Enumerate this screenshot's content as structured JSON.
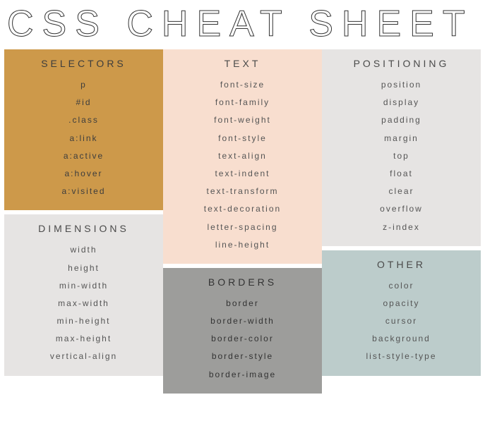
{
  "title": "CSS CHEAT SHEET",
  "sections": {
    "selectors": {
      "header": "SELECTORS",
      "items": [
        "p",
        "#id",
        ".class",
        "a:link",
        "a:active",
        "a:hover",
        "a:visited"
      ]
    },
    "dimensions": {
      "header": "DIMENSIONS",
      "items": [
        "width",
        "height",
        "min-width",
        "max-width",
        "min-height",
        "max-height",
        "vertical-align"
      ]
    },
    "text": {
      "header": "TEXT",
      "items": [
        "font-size",
        "font-family",
        "font-weight",
        "font-style",
        "text-align",
        "text-indent",
        "text-transform",
        "text-decoration",
        "letter-spacing",
        "line-height"
      ]
    },
    "borders": {
      "header": "BORDERS",
      "items": [
        "border",
        "border-width",
        "border-color",
        "border-style",
        "border-image"
      ]
    },
    "positioning": {
      "header": "POSITIONING",
      "items": [
        "position",
        "display",
        "padding",
        "margin",
        "top",
        "float",
        "clear",
        "overflow",
        "z-index"
      ]
    },
    "other": {
      "header": "OTHER",
      "items": [
        "color",
        "opacity",
        "cursor",
        "background",
        "list-style-type"
      ]
    }
  }
}
